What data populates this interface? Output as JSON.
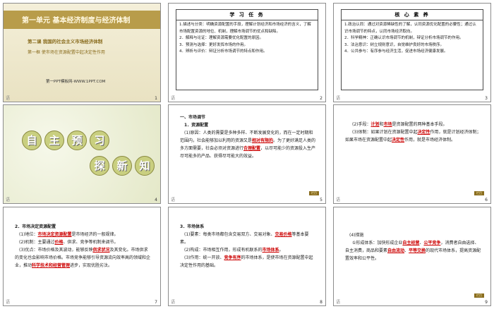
{
  "slide1": {
    "title": "第一单元  基本经济制度与经济体制",
    "lesson": "第二课   我国的社会主义市场经济体制",
    "frame": "第一框   使市场在资源配置中起决定性作用",
    "site": "第一PPT模板网-WWW.1PPT.COM",
    "footer": "语",
    "num": "1"
  },
  "slide2": {
    "header": "学 习 任 务",
    "items": [
      "1.描述与分类：明确资源配置的手段，理解计划经济和市场经济的含义，了解市场配置资源的地位、机制，理解市场调节的优点和缺陷。",
      "2．解释与论证：理解资源需要优化配置的原因。",
      "3．预测与选择：更好发挥市场的作用。",
      "4．辨析与评价：辩证分析市场调节的特点和作用。"
    ],
    "footer": "语",
    "num": "2"
  },
  "slide3": {
    "header": "核 心 素 养",
    "items": [
      "1.政治认同：通过对资源稀缺性的了解，认同资源优化配置的必要性；通过认识市场调节的特点，认同市场经济取向。",
      "2．科学精神：正确认识市场调节的机制，辩证分析市场调节的作用。",
      "3．法治意识：树立规则意识，自觉维护良好的市场秩序。",
      "4．公共参与：有序参与经济生活，促进市场经济健康发展。"
    ],
    "footer": "语",
    "num": "3"
  },
  "slide4": {
    "chars1": [
      "自",
      "主",
      "预",
      "习"
    ],
    "chars2": [
      "探",
      "新",
      "知"
    ],
    "footer": "语",
    "num": "4"
  },
  "slide5": {
    "h1": "一、市场调节",
    "h2": "1．资源配置",
    "p1a": "(1)原因：人类的需要是多种多样、不断发展变化的，而在一定时期和范围内，社会能够加以利用的资源又是",
    "p1hl": "相对有限的",
    "p1b": "。为了更好满足人类的多方面需要，社会必须对资源进行",
    "p1hl2": "合理配置",
    "p1c": "，以尽可能少的资源投入生产尽可能多的产品、获得尽可能大的效益。",
    "tag": "栏目",
    "footer": "语",
    "num": "5"
  },
  "slide6": {
    "p1a": "(2)手段：",
    "p1hl1": "计划",
    "p1b": "和",
    "p1hl2": "市场",
    "p1c": "是资源配置的两种基本手段。",
    "p2a": "(3)体制：如果计划在资源配置中起",
    "p2hl": "决定性",
    "p2b": "作用，就是计划经济体制；如果市场在资源配置中起",
    "p2hl2": "决定性",
    "p2c": "作用，就是市场经济体制。",
    "tag": "栏目",
    "footer": "语",
    "num": "6"
  },
  "slide7": {
    "h": "2．市场决定资源配置",
    "p1a": "(1)地位：",
    "p1hl": "市场决定资源配置",
    "p1b": "是市场经济的一般规律。",
    "p2a": "(2)机制：主要通过",
    "p2hl": "价格",
    "p2b": "、供求、竞争等机制来调节。",
    "p3a": "(3)优点：市场价格及其波动，能够反映",
    "p3hl": "供求状况",
    "p3b": "及其变化。市场供求的变化也会影响市场价格。市场竞争能够引导资源流向效率高的领域和企业，推动",
    "p3hl2": "科学技术和经营管理",
    "p3c": "进步，实现优胜劣汰。",
    "footer": "语",
    "num": "7"
  },
  "slide8": {
    "h": "3．市场体系",
    "p1a": "(1)要素：每类市场都包含交易双方、交易对象、",
    "p1hl": "交易价格",
    "p1b": "等基本要素。",
    "p2a": "(2)构成：市场相互作用，形成有机联系的",
    "p2hl": "市场体系",
    "p2b": "。",
    "p3a": "(3)作用：统一开放、",
    "p3hl": "竞争有序",
    "p3b": "的市场体系，是使市场在资源配置中起决定性作用的基础。",
    "footer": "语",
    "num": "8"
  },
  "slide9": {
    "h": "(4)措施",
    "p1a": "①形成体系：加快形成企业",
    "p1hl": "自主经营",
    "p1b": "、",
    "p1hl2": "公平竞争",
    "p1c": "，消费者自由选择、自主消费，商品和要素",
    "p1hl3": "自由流动",
    "p1d": "、",
    "p1hl4": "平等交换",
    "p1e": "的现代市场体系，提高资源配置效率和公平性。",
    "tag": "栏目",
    "footer": "语",
    "num": "9"
  }
}
